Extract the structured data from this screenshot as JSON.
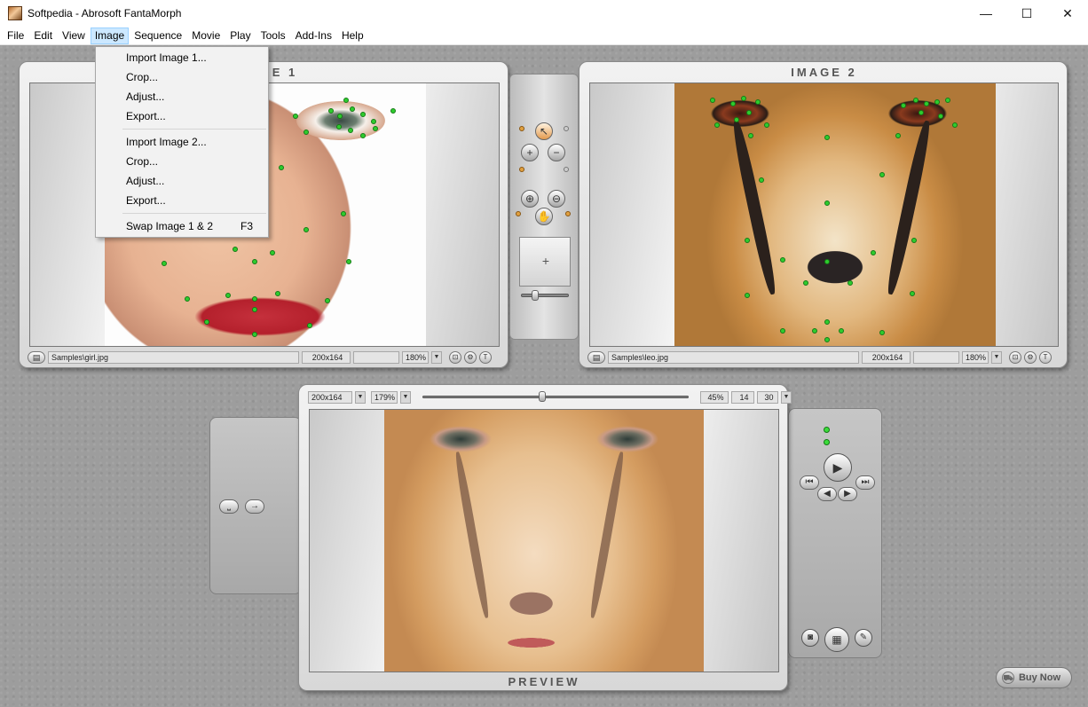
{
  "window": {
    "title": "Softpedia - Abrosoft FantaMorph",
    "minimize": "—",
    "maximize": "☐",
    "close": "✕"
  },
  "menubar": {
    "items": [
      "File",
      "Edit",
      "View",
      "Image",
      "Sequence",
      "Movie",
      "Play",
      "Tools",
      "Add-Ins",
      "Help"
    ]
  },
  "image_menu": {
    "import1": "Import Image 1...",
    "crop1": "Crop...",
    "adjust1": "Adjust...",
    "export1": "Export...",
    "import2": "Import Image 2...",
    "crop2": "Crop...",
    "adjust2": "Adjust...",
    "export2": "Export...",
    "swap": "Swap Image 1 & 2",
    "swap_key": "F3"
  },
  "image1": {
    "label": "IMAGE 1",
    "path": "Samples\\girl.jpg",
    "size": "200x164",
    "zoom": "180%"
  },
  "image2": {
    "label": "IMAGE 2",
    "path": "Samples\\leo.jpg",
    "size": "200x164",
    "zoom": "180%"
  },
  "preview": {
    "label": "PREVIEW",
    "size": "200x164",
    "zoom": "179%",
    "percent": "45%",
    "frame": "14",
    "fps": "30",
    "position": 0.45
  },
  "buy": {
    "label": "Buy Now"
  },
  "colors": {
    "accent": "#cce8ff",
    "dot": "#2ecc2e",
    "panel": "#e4e4e4"
  }
}
